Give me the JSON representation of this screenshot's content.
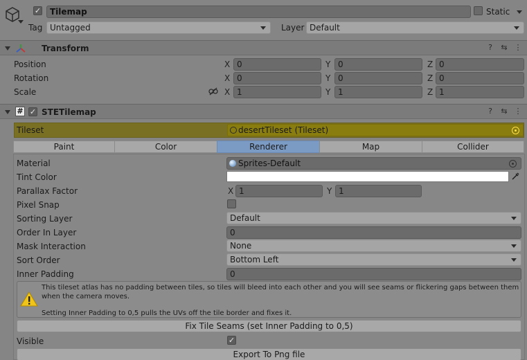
{
  "object": {
    "name": "Tilemap",
    "active": true,
    "static_label": "Static",
    "tag_label": "Tag",
    "tag_value": "Untagged",
    "layer_label": "Layer",
    "layer_value": "Default"
  },
  "transform": {
    "title": "Transform",
    "rows": [
      {
        "label": "Position",
        "x": "0",
        "y": "0",
        "z": "0"
      },
      {
        "label": "Rotation",
        "x": "0",
        "y": "0",
        "z": "0"
      },
      {
        "label": "Scale",
        "x": "1",
        "y": "1",
        "z": "1"
      }
    ],
    "axes": {
      "x": "X",
      "y": "Y",
      "z": "Z"
    }
  },
  "ste_tilemap": {
    "title": "STETilemap",
    "enabled": true,
    "tileset_label": "Tileset",
    "tileset_value": "desertTileset (Tileset)",
    "tabs": [
      "Paint",
      "Color",
      "Renderer",
      "Map",
      "Collider"
    ],
    "active_tab": "Renderer",
    "material_label": "Material",
    "material_value": "Sprites-Default",
    "tint_color_label": "Tint Color",
    "tint_color": "#ffffff",
    "parallax_label": "Parallax Factor",
    "parallax_x": "1",
    "parallax_y": "1",
    "pixel_snap_label": "Pixel Snap",
    "pixel_snap": false,
    "sorting_layer_label": "Sorting Layer",
    "sorting_layer_value": "Default",
    "order_in_layer_label": "Order In Layer",
    "order_in_layer_value": "0",
    "mask_interaction_label": "Mask Interaction",
    "mask_interaction_value": "None",
    "sort_order_label": "Sort Order",
    "sort_order_value": "Bottom Left",
    "inner_padding_label": "Inner Padding",
    "inner_padding_value": "0",
    "warning_text_1": "This tileset atlas has no padding between tiles, so tiles will bleed into each other and you will see seams or flickering gaps between them when the camera moves.",
    "warning_text_2": "Setting Inner Padding to 0,5 pulls the UVs off the tile border and fixes it.",
    "fix_button": "Fix Tile Seams (set Inner Padding to 0,5)",
    "visible_label": "Visible",
    "visible": true,
    "export_button": "Export To Png file"
  },
  "colors": {
    "background": "#858585",
    "tileset_highlight": "#7a7024",
    "tileset_field": "#8a7d10",
    "active_tab": "#7c9bc4"
  },
  "icons": {
    "object": "cube-icon",
    "transform": "transform-axes-icon",
    "script": "hash-icon",
    "help": "help-icon",
    "presets": "presets-icon",
    "menu": "kebab-menu-icon",
    "warning": "warning-icon",
    "link": "unlink-icon",
    "eyedropper": "eyedropper-icon"
  }
}
